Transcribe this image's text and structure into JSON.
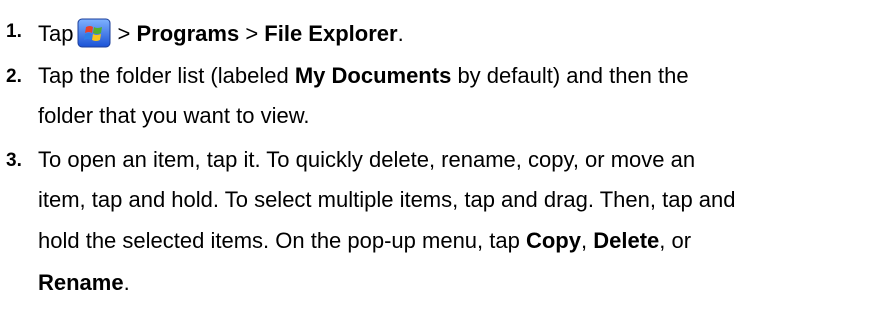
{
  "steps": [
    {
      "number": "1.",
      "text": {
        "tap": "Tap",
        "sep1": ">",
        "programs": "Programs",
        "sep2": ">",
        "file_explorer": "File Explorer",
        "end": "."
      },
      "icon": "windows-start-icon"
    },
    {
      "number": "2.",
      "line1": {
        "pre": "Tap the folder list (labeled",
        "bold": "My Documents",
        "post": "by default) and then the"
      },
      "line2": "folder that you want to view."
    },
    {
      "number": "3.",
      "line1": "To open an item, tap it. To quickly delete, rename, copy, or move an",
      "line2": "item, tap and hold. To select multiple items, tap and drag. Then, tap and",
      "line3": {
        "pre": "hold the selected items. On the pop-up menu, tap",
        "copy": "Copy",
        "comma1": ",",
        "delete": "Delete",
        "post": ", or"
      },
      "line4": {
        "rename": "Rename",
        "end": "."
      }
    }
  ],
  "colors": {
    "text": "#000000",
    "background": "#ffffff"
  }
}
